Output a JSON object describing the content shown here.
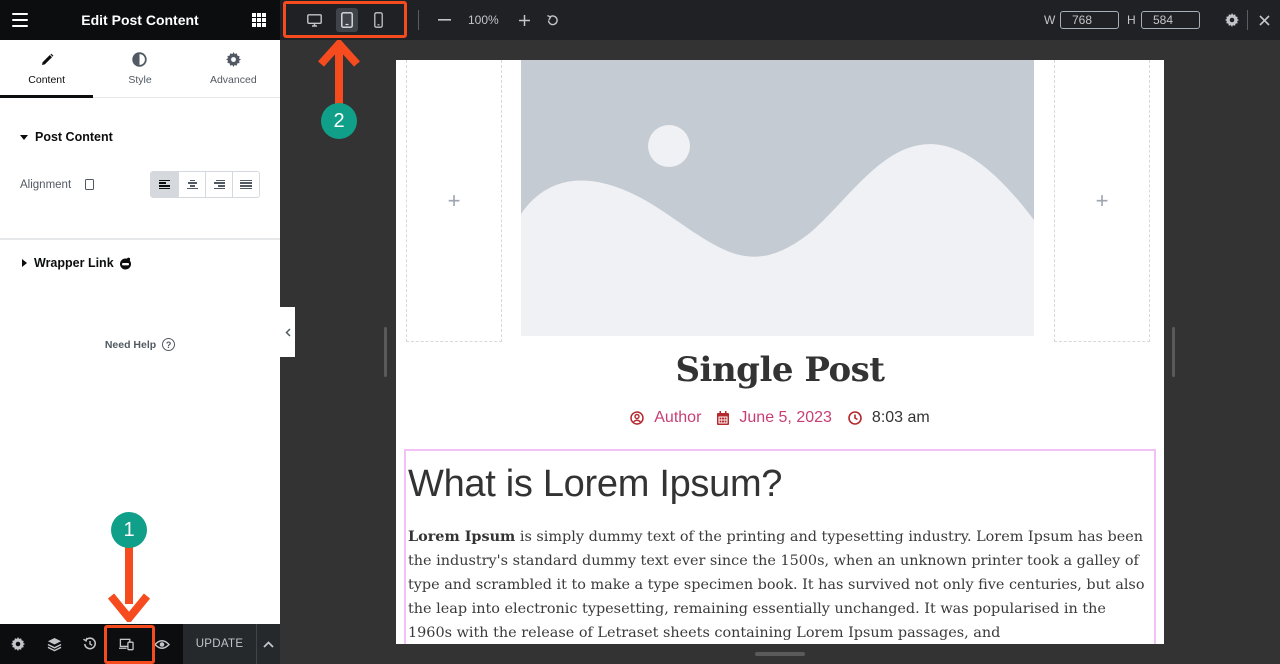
{
  "panel": {
    "title": "Edit Post Content",
    "tabs": [
      {
        "label": "Content",
        "icon": "pencil-icon",
        "active": true
      },
      {
        "label": "Style",
        "icon": "half-circle-icon",
        "active": false
      },
      {
        "label": "Advanced",
        "icon": "gear-icon",
        "active": false
      }
    ],
    "sections": {
      "post_content": "Post Content",
      "wrapper_link": "Wrapper Link"
    },
    "alignment": {
      "label": "Alignment",
      "options": [
        "left",
        "center",
        "right",
        "justify"
      ],
      "selected": "left"
    },
    "need_help": "Need Help",
    "footer": {
      "buttons": [
        "settings",
        "navigator",
        "history",
        "responsive-mode",
        "preview"
      ],
      "update_label": "UPDATE"
    }
  },
  "topbar": {
    "devices": [
      {
        "name": "desktop",
        "active": false
      },
      {
        "name": "tablet",
        "active": true
      },
      {
        "name": "mobile",
        "active": false
      }
    ],
    "zoom": "100%",
    "width_label": "W",
    "width_value": "768",
    "height_label": "H",
    "height_value": "584"
  },
  "post": {
    "title": "Single Post",
    "meta": {
      "author": "Author",
      "date": "June 5, 2023",
      "time": "8:03 am"
    },
    "heading": "What is Lorem Ipsum?",
    "para_bold": "Lorem Ipsum",
    "para_rest": " is simply dummy text of the printing and typesetting industry. Lorem Ipsum has been the industry's standard dummy text ever since the 1500s, when an unknown printer took a galley of type and scrambled it to make a type specimen book. It has survived not only five centuries, but also the leap into electronic typesetting, remaining essentially unchanged. It was popularised in the 1960s with the release of Letraset sheets containing Lorem Ipsum passages, and"
  },
  "annotations": {
    "step1": "1",
    "step2": "2",
    "color": "#f54b1f",
    "badge_color": "#10a08a"
  },
  "colors": {
    "accent_pink": "#c73e75",
    "meta_icon": "#b5282d"
  }
}
